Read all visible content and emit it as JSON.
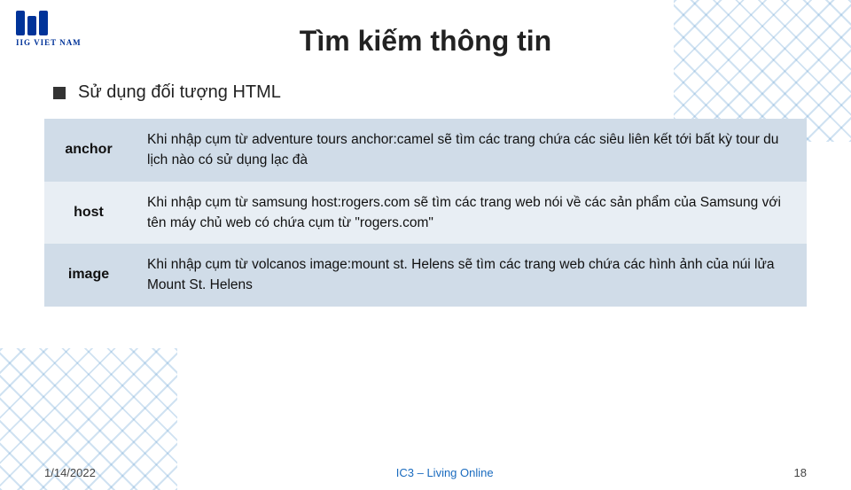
{
  "title": "Tìm kiếm thông tin",
  "logo": {
    "text": "IIG VIET NAM"
  },
  "bullet": {
    "text": "Sử dụng đối tượng HTML"
  },
  "table": {
    "rows": [
      {
        "term": "anchor",
        "description": "Khi nhập cụm từ adventure tours anchor:camel sẽ tìm các trang chứa các siêu liên kết tới bất kỳ tour du lịch nào có sử dụng lạc đà"
      },
      {
        "term": "host",
        "description": "Khi nhập cụm từ samsung host:rogers.com sẽ tìm các trang web nói về các sản phẩm của Samsung với tên máy chủ web có chứa cụm từ \"rogers.com\""
      },
      {
        "term": "image",
        "description": "Khi nhập cụm từ volcanos image:mount st. Helens sẽ tìm các trang web chứa các hình ảnh của núi lửa Mount St. Helens"
      }
    ]
  },
  "footer": {
    "date": "1/14/2022",
    "center": "IC3 – Living Online",
    "page": "18"
  }
}
